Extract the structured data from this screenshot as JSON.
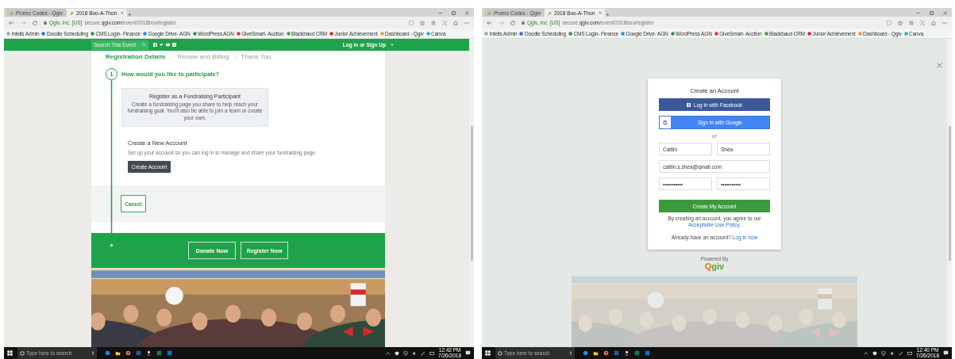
{
  "screens": [
    {
      "tabs": [
        {
          "label": "Promo Codes - Qgiv",
          "selected": false
        },
        {
          "label": "2018 Boo-A-Thon",
          "selected": true
        }
      ],
      "address": {
        "site": "Qgiv, Inc. [US]",
        "url": "secure.**qgiv.com**/event/2018boo/register"
      },
      "bookmarks": [
        "Intelis Admin",
        "Doodle Scheduling",
        "CMS Login- Finance",
        "Google Drive- AGN",
        "WordPress AGN",
        "GiveSmart- Auction",
        "Blackbaud CRM",
        "Junior Achievement",
        "Dashboard - Qgiv",
        "Canva"
      ],
      "page": {
        "kind": "registration",
        "search_placeholder": "Search This Event",
        "account_link": "Log in or Sign Up",
        "steps": [
          {
            "label": "Registration Details",
            "selected": true
          },
          {
            "label": "Review and Billing",
            "selected": false
          },
          {
            "label": "Thank You",
            "selected": false
          }
        ],
        "step_number": "1",
        "question": "How would you like to participate?",
        "option": {
          "title": "Register as a Fundraising Participant",
          "description": "Create a fundraising page you share to help reach your fundraising goal. You'll also be able to join a team or create your own."
        },
        "account": {
          "title": "Create a New Account",
          "description": "Set up your account so you can log in to manage and share your fundraising page.",
          "button": "Create Account"
        },
        "cancel": "Cancel",
        "actions": [
          "Donate Now",
          "Register Now"
        ]
      },
      "taskbar": {
        "search_placeholder": "Type here to search",
        "time": "12:42 PM",
        "date": "7/26/2018"
      }
    },
    {
      "tabs": [
        {
          "label": "Promo Codes - Qgiv",
          "selected": false
        },
        {
          "label": "2018 Boo-A-Thon",
          "selected": true
        }
      ],
      "address": {
        "site": "Qgiv, Inc. [US]",
        "url": "secure.**qgiv.com**/event/2018boo/register"
      },
      "bookmarks": [
        "Intelis Admin",
        "Doodle Scheduling",
        "CMS Login- Finance",
        "Google Drive- AGN",
        "WordPress AGN",
        "GiveSmart- Auction",
        "Blackbaud CRM",
        "Junior Achievement",
        "Dashboard - Qgiv",
        "Canva"
      ],
      "page": {
        "kind": "signup",
        "title": "Create an Account",
        "facebook": "Log in with Facebook",
        "google": "Sign in with Google",
        "divider": "or",
        "field_rows": [
          [
            "Caitlin",
            "Shea"
          ],
          [
            "caitlin.s.shea@gmail.com"
          ],
          [
            "•••••••••••",
            "•••••••••••"
          ]
        ],
        "submit": "Create My Account",
        "terms": "By creating an account, you agree to our",
        "terms_link": "Acceptable Use Policy.",
        "login_prompt": "Already have an account?",
        "login_link": "Log in now",
        "powered_by": "Powered By",
        "logo": "Qgiv"
      },
      "taskbar": {
        "search_placeholder": "Type here to search",
        "time": "12:40 PM",
        "date": "7/26/2018"
      }
    }
  ]
}
